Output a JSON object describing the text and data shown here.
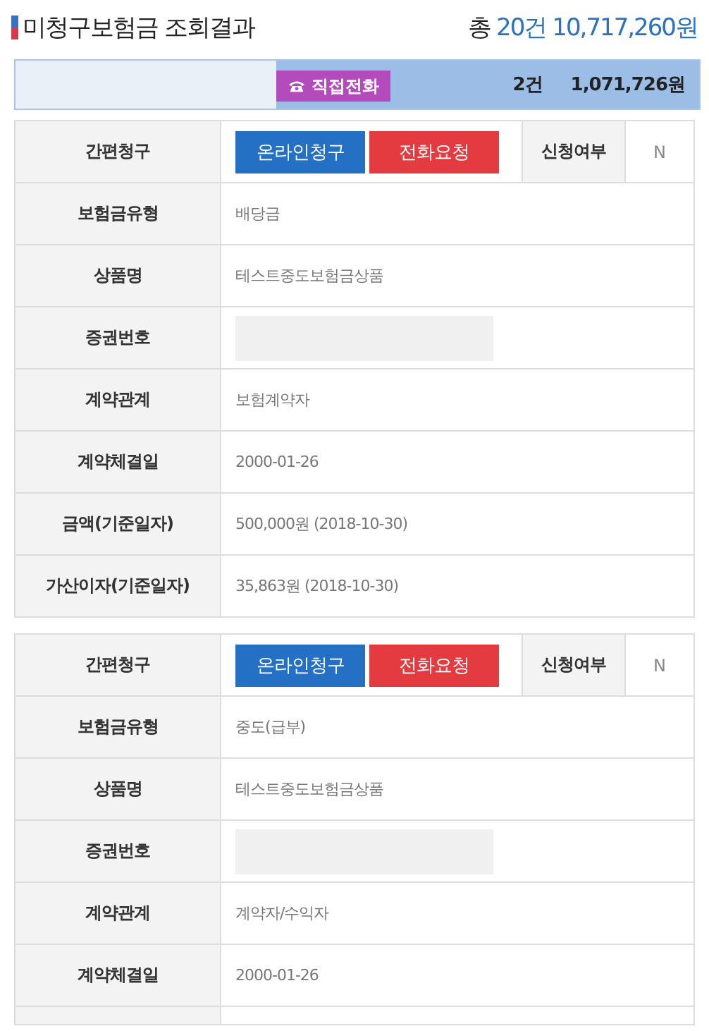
{
  "header": {
    "title": "미청구보험금 조회결과",
    "total_prefix": "총",
    "total_count": "20건",
    "total_amount": "10,717,260원"
  },
  "summary": {
    "button": "직접전화",
    "count": "2건",
    "amount": "1,071,726원"
  },
  "cards": [
    {
      "rows": [
        {
          "kind": "claim",
          "label": "간편청구",
          "buttons": [
            {
              "label": "온라인청구",
              "kind": "online"
            },
            {
              "label": "전화요청",
              "kind": "phone"
            }
          ],
          "status_label": "신청여부",
          "status_value": "N"
        },
        {
          "kind": "field",
          "label": "보험금유형",
          "value": "배당금"
        },
        {
          "kind": "field",
          "label": "상품명",
          "value": "테스트중도보험금상품"
        },
        {
          "kind": "masked",
          "label": "증권번호"
        },
        {
          "kind": "field",
          "label": "계약관계",
          "value": "보험계약자"
        },
        {
          "kind": "field",
          "label": "계약체결일",
          "value": "2000-01-26"
        },
        {
          "kind": "field",
          "label": "금액(기준일자)",
          "value": "500,000원 (2018-10-30)"
        },
        {
          "kind": "field",
          "label": "가산이자(기준일자)",
          "value": "35,863원 (2018-10-30)"
        }
      ]
    },
    {
      "rows": [
        {
          "kind": "claim",
          "label": "간편청구",
          "buttons": [
            {
              "label": "온라인청구",
              "kind": "online"
            },
            {
              "label": "전화요청",
              "kind": "phone"
            }
          ],
          "status_label": "신청여부",
          "status_value": "N"
        },
        {
          "kind": "field",
          "label": "보험금유형",
          "value": "중도(급부)"
        },
        {
          "kind": "field",
          "label": "상품명",
          "value": "테스트중도보험금상품"
        },
        {
          "kind": "masked",
          "label": "증권번호"
        },
        {
          "kind": "field",
          "label": "계약관계",
          "value": "계약자/수익자"
        },
        {
          "kind": "field",
          "label": "계약체결일",
          "value": "2000-01-26"
        },
        {
          "kind": "blank"
        }
      ]
    }
  ]
}
